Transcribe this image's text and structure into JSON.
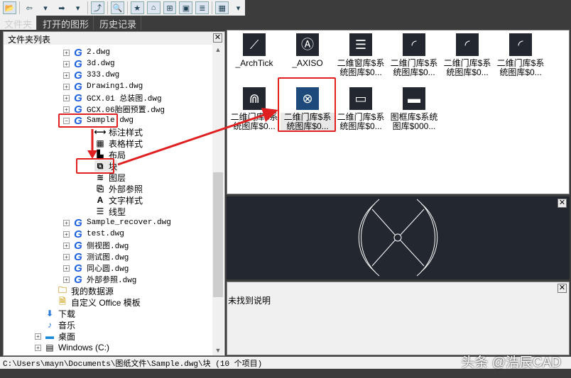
{
  "toolbar": {
    "buttons": [
      "open-folder-icon",
      "back-icon",
      "back-dropdown-icon",
      "forward-icon",
      "forward-dropdown-icon",
      "up-folder-icon",
      "search-icon",
      "favorites-icon",
      "home-icon",
      "tree-view-icon",
      "preview-icon",
      "description-icon",
      "views-icon",
      "views-dropdown-icon"
    ]
  },
  "tabs": [
    {
      "label": "文件夹"
    },
    {
      "label": "打开的图形"
    },
    {
      "label": "历史记录"
    }
  ],
  "folder_panel": {
    "title": "文件夹列表",
    "close": "✕"
  },
  "tree": [
    {
      "label": "2.dwg",
      "type": "dwg",
      "level": 2,
      "expander": "+"
    },
    {
      "label": "3d.dwg",
      "type": "dwg",
      "level": 2,
      "expander": "+"
    },
    {
      "label": "333.dwg",
      "type": "dwg",
      "level": 2,
      "expander": "+"
    },
    {
      "label": "Drawing1.dwg",
      "type": "dwg",
      "level": 2,
      "expander": "+"
    },
    {
      "label": "GCX.01 总装图.dwg",
      "type": "dwg",
      "level": 2,
      "expander": "+"
    },
    {
      "label": "GCX.06胎圈预置.dwg",
      "type": "dwg",
      "level": 2,
      "expander": "+"
    },
    {
      "label": "Sample.dwg",
      "type": "dwg",
      "level": 2,
      "expander": "−",
      "highlighted": true
    },
    {
      "label": "标注样式",
      "type": "dimstyle",
      "level": 3
    },
    {
      "label": "表格样式",
      "type": "tablestyle",
      "level": 3
    },
    {
      "label": "布局",
      "type": "layout",
      "level": 3
    },
    {
      "label": "块",
      "type": "block",
      "level": 3,
      "highlighted": true,
      "selected": true
    },
    {
      "label": "图层",
      "type": "layer",
      "level": 3
    },
    {
      "label": "外部参照",
      "type": "xref",
      "level": 3
    },
    {
      "label": "文字样式",
      "type": "textstyle",
      "level": 3
    },
    {
      "label": "线型",
      "type": "linetype",
      "level": 3
    },
    {
      "label": "Sample_recover.dwg",
      "type": "dwg",
      "level": 2,
      "expander": "+"
    },
    {
      "label": "test.dwg",
      "type": "dwg",
      "level": 2,
      "expander": "+"
    },
    {
      "label": "侧视图.dwg",
      "type": "dwg",
      "level": 2,
      "expander": "+"
    },
    {
      "label": "测试图.dwg",
      "type": "dwg",
      "level": 2,
      "expander": "+"
    },
    {
      "label": "同心圆.dwg",
      "type": "dwg",
      "level": 2,
      "expander": "+"
    },
    {
      "label": "外部参照.dwg",
      "type": "dwg",
      "level": 2,
      "expander": "+"
    },
    {
      "label": "我的数据源",
      "type": "datasource",
      "level": 1
    },
    {
      "label": "自定义 Office 模板",
      "type": "template",
      "level": 1
    },
    {
      "label": "下载",
      "type": "download",
      "level": 0
    },
    {
      "label": "音乐",
      "type": "music",
      "level": 0
    },
    {
      "label": "桌面",
      "type": "desktop",
      "level": 0,
      "expander": "+"
    },
    {
      "label": "Windows (C:)",
      "type": "drive",
      "level": 0,
      "expander": "+"
    }
  ],
  "blocks": [
    {
      "label": "_ArchTick",
      "glyph": "⟋"
    },
    {
      "label": "_AXISO",
      "glyph": "Ⓐ"
    },
    {
      "label": "二维窗库$系统图库$0...",
      "glyph": "☰"
    },
    {
      "label": "二维门库$系统图库$0...",
      "glyph": "◜"
    },
    {
      "label": "二维门库$系统图库$0...",
      "glyph": "◜"
    },
    {
      "label": "二维门库$系统图库$0...",
      "glyph": "◜"
    },
    {
      "label": "二维门库$系统图库$0...",
      "glyph": "⋒"
    },
    {
      "label": "二维门库$系统图库$0...",
      "glyph": "⊗",
      "selected": true
    },
    {
      "label": "二维门库$系统图库$0...",
      "glyph": "▭"
    },
    {
      "label": "图框库$系统图库$000...",
      "glyph": "▬"
    }
  ],
  "preview": {
    "close": "✕"
  },
  "description": {
    "text": "未找到说明",
    "close": "✕"
  },
  "status": {
    "path": "C:\\Users\\mayn\\Documents\\图纸文件\\Sample.dwg\\块",
    "count": "(10 个项目)"
  },
  "watermark": "头条 @浩辰CAD",
  "colors": {
    "highlight": "#e02020",
    "preview_bg": "#232830",
    "dwg_icon": "#1a5fe0"
  }
}
